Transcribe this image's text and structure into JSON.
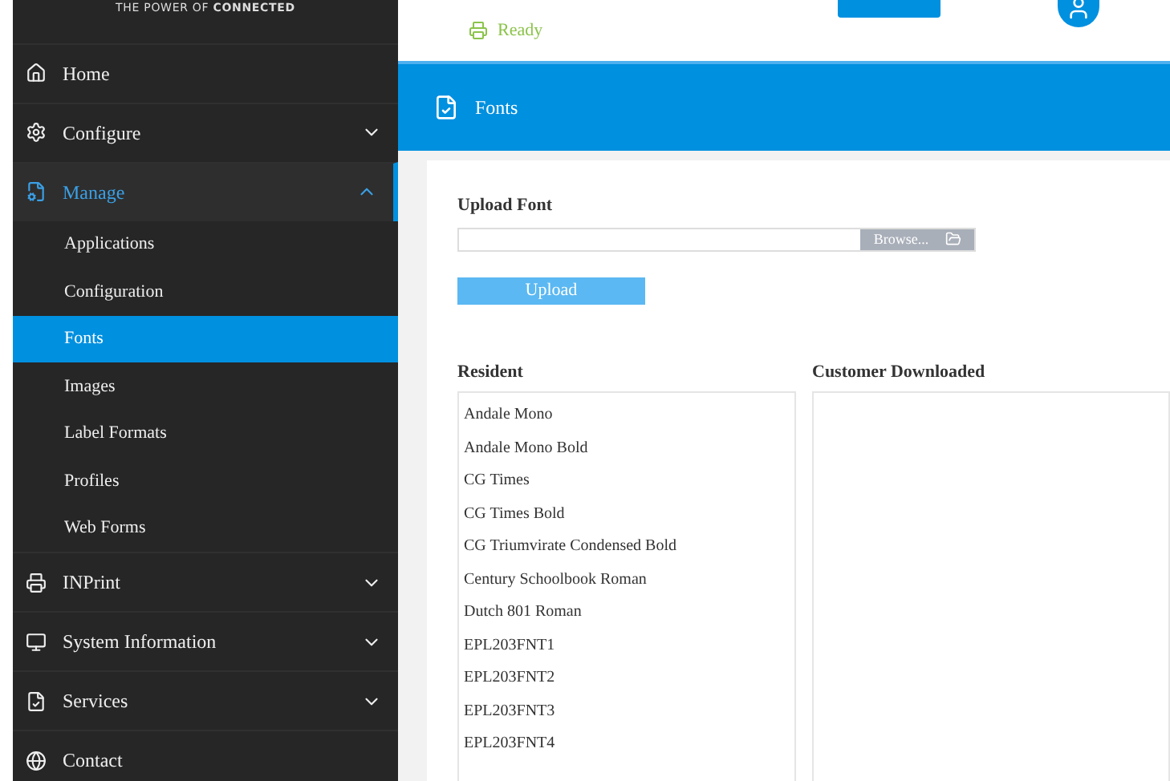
{
  "logo": {
    "tagline": "THE POWER OF **CONNECTED**"
  },
  "status": {
    "text": "Ready"
  },
  "sidebar": {
    "items": [
      {
        "label": "Home",
        "kind": "link",
        "expanded": false
      },
      {
        "label": "Configure",
        "kind": "group",
        "expanded": false
      },
      {
        "label": "Manage",
        "kind": "group",
        "expanded": true,
        "children": [
          {
            "label": "Applications",
            "selected": false
          },
          {
            "label": "Configuration",
            "selected": false
          },
          {
            "label": "Fonts",
            "selected": true
          },
          {
            "label": "Images",
            "selected": false
          },
          {
            "label": "Label Formats",
            "selected": false
          },
          {
            "label": "Profiles",
            "selected": false
          },
          {
            "label": "Web Forms",
            "selected": false
          }
        ]
      },
      {
        "label": "INPrint",
        "kind": "group",
        "expanded": false
      },
      {
        "label": "System Information",
        "kind": "group",
        "expanded": false
      },
      {
        "label": "Services",
        "kind": "group",
        "expanded": false
      },
      {
        "label": "Contact",
        "kind": "link",
        "expanded": false
      }
    ]
  },
  "page_title": "Fonts",
  "upload": {
    "label": "Upload Font",
    "browse": "Browse...",
    "button": "Upload"
  },
  "resident": {
    "title": "Resident",
    "fonts": [
      "Andale Mono",
      "Andale Mono Bold",
      "CG Times",
      "CG Times Bold",
      "CG Triumvirate Condensed Bold",
      "Century Schoolbook Roman",
      "Dutch 801 Roman",
      "EPL203FNT1",
      "EPL203FNT2",
      "EPL203FNT3",
      "EPL203FNT4"
    ]
  },
  "customer": {
    "title": "Customer Downloaded"
  }
}
